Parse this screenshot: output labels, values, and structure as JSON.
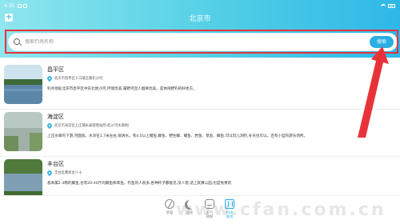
{
  "status_bar": {
    "time": "4:35"
  },
  "header": {
    "title": "北京市",
    "add_icon": "plus-square-icon"
  },
  "search": {
    "placeholder": "搜索钓场名称",
    "button_label": "搜索"
  },
  "spots": [
    {
      "name": "昌平区",
      "address": "北京市昌平区十三陵庄路北沙河",
      "description": "钓点地处北京市昌平区中东北地沙河,环境优美,属野河且人烟稀优美。是休闲野钓的好地方。",
      "thumb": "lake-landscape"
    },
    {
      "name": "海淀区",
      "address": "北京市海淀区上庄镇永泰管理站西(北沙河水源地)",
      "description": "上庄水库的下游,河面宽。水深在1.7米左右,很清水。有4.5以上鲤鱼,鲫鱼、野生鲫、鲤鱼、岩鱼、草鱼、鲫鱼,可以玩儿洞钓,冬天也可以。还有小型的游乐场所。",
      "thumb": "river-grass"
    },
    {
      "name": "丰台区",
      "address": "丰台区鹰状金八十",
      "description": "基本属2-3两的鲫鱼,也有20-40斤的鲫鱼和草鱼。钓鱼的人很多,各种杆子都能见,没人管,适上就算公园,也是免费的",
      "thumb": "pond-trees"
    }
  ],
  "bottom_nav": [
    {
      "label": "罗盘",
      "icon": "compass-icon",
      "active": false
    },
    {
      "label": "月亮",
      "icon": "moon-icon",
      "active": false
    },
    {
      "label": "天气\n预报",
      "icon": "weather-icon",
      "active": false
    },
    {
      "label": "钓场\n查找",
      "icon": "map-icon",
      "active": true
    }
  ],
  "watermark": "www.cfan.com.cn",
  "colors": {
    "header_start": "#8fe6ee",
    "header_end": "#2fb7e8",
    "accent": "#2aaee3",
    "highlight": "#e8323a"
  }
}
